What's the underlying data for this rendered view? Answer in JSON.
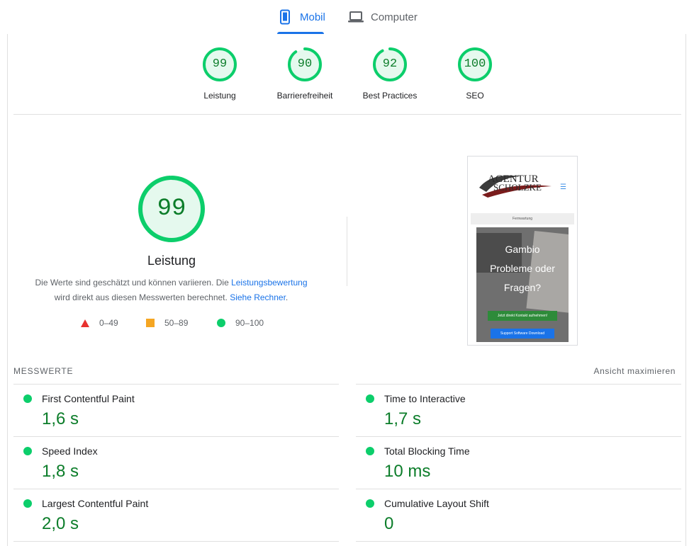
{
  "tabs": [
    {
      "label": "Mobil",
      "icon": "smartphone-icon",
      "active": true
    },
    {
      "label": "Computer",
      "icon": "laptop-icon",
      "active": false
    }
  ],
  "categories": [
    {
      "score": "99",
      "label": "Leistung",
      "value": 99
    },
    {
      "score": "90",
      "label": "Barrierefreiheit",
      "value": 90
    },
    {
      "score": "92",
      "label": "Best Practices",
      "value": 92
    },
    {
      "score": "100",
      "label": "SEO",
      "value": 100
    }
  ],
  "performance": {
    "score": "99",
    "value": 99,
    "title": "Leistung",
    "desc_part1": "Die Werte sind geschätzt und können variieren. Die ",
    "desc_link1": "Leistungsbewertung",
    "desc_part2": "wird direkt aus diesen Messwerten berechnet. ",
    "desc_link2": "Siehe Rechner",
    "desc_end": "."
  },
  "legend": [
    {
      "range": "0–49",
      "color": "#e8322f"
    },
    {
      "range": "50–89",
      "color": "#f5a623"
    },
    {
      "range": "90–100",
      "color": "#0cce6b"
    }
  ],
  "screenshot": {
    "logo_line1": "AGENTUR",
    "logo_line2": "SCHOLZKE",
    "strip_text": "Fernwartung",
    "hero_line1": "Gambio",
    "hero_line2": "Probleme oder",
    "hero_line3": "Fragen?",
    "button1": "Jetzt direkt Kontakt aufnehmen!",
    "button2": "Support Software Download"
  },
  "metrics": {
    "header": "MESSWERTE",
    "expand_label": "Ansicht maximieren",
    "items": [
      {
        "name": "First Contentful Paint",
        "value": "1,6 s"
      },
      {
        "name": "Time to Interactive",
        "value": "1,7 s"
      },
      {
        "name": "Speed Index",
        "value": "1,8 s"
      },
      {
        "name": "Total Blocking Time",
        "value": "10 ms"
      },
      {
        "name": "Largest Contentful Paint",
        "value": "2,0 s"
      },
      {
        "name": "Cumulative Layout Shift",
        "value": "0"
      }
    ]
  },
  "colors": {
    "pass": "#0cce6b",
    "pass_text": "#0c7d2a",
    "gauge_bg": "#e5f9ee",
    "accent": "#1a73e8"
  }
}
